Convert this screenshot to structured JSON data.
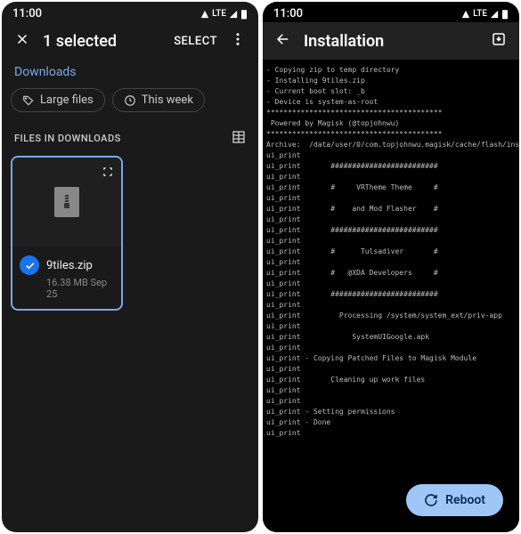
{
  "statusbar": {
    "time": "11:00",
    "lte": "LTE"
  },
  "left": {
    "title": "1 selected",
    "select": "SELECT",
    "breadcrumb": "Downloads",
    "chips": {
      "large": "Large files",
      "week": "This week"
    },
    "section": "FILES IN DOWNLOADS",
    "file": {
      "name": "9tiles.zip",
      "meta": "16.38 MB Sep 25"
    }
  },
  "right": {
    "title": "Installation",
    "reboot": "Reboot",
    "console": "- Copying zip to temp directory\n- Installing 9tiles.zip\n- Current boot slot: _b\n- Device is system-as-root\n*****************************************\n Powered by Magisk (@topjohnwu)\n*****************************************\nArchive:  /data/user/0/com.topjohnwu.magisk/cache/flash/ins\nui_print\nui_print       #########################\nui_print\nui_print       #     VRTheme Theme     #\nui_print\nui_print       #    and Mod Flasher    #\nui_print\nui_print       #########################\nui_print\nui_print       #      Tulsadiver       #\nui_print\nui_print       #   @XDA Developers     #\nui_print\nui_print       #########################\nui_print\nui_print         Processing /system/system_ext/priv-app\nui_print\nui_print            SystemUIGoogle.apk\nui_print\nui_print - Copying Patched Files to Magisk Module\nui_print\nui_print       Cleaning up work files\nui_print\nui_print\nui_print - Setting permissions\nui_print - Done\nui_print"
  }
}
